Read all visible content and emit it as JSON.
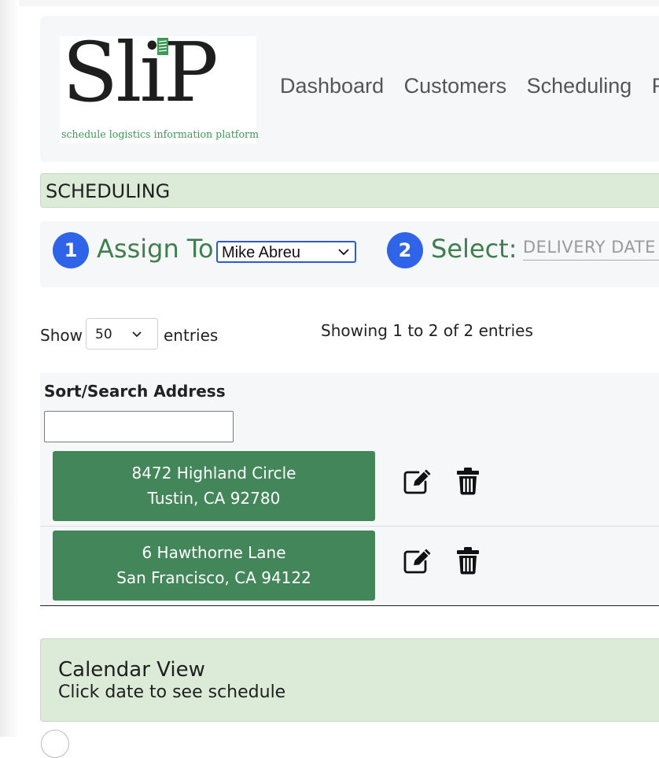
{
  "brand": {
    "logo_text": "SliP",
    "tagline": "schedule logistics information platform",
    "accent_green": "#43865a",
    "header_green": "#dcebd8",
    "step_blue": "#2f63e8"
  },
  "nav": {
    "items": [
      "Dashboard",
      "Customers",
      "Scheduling",
      "Rou"
    ]
  },
  "section": {
    "title": "SCHEDULING"
  },
  "assign": {
    "step1_number": "1",
    "step1_label": "Assign To:",
    "assignee_selected": "Mike Abreu",
    "step2_number": "2",
    "step2_label": "Select:",
    "date_placeholder": "DELIVERY DATE"
  },
  "table_controls": {
    "show_label": "Show",
    "page_length_selected": "50",
    "entries_label": "entries",
    "info_text": "Showing 1 to 2 of 2 entries"
  },
  "table": {
    "column_header": "Sort/Search Address",
    "search_value": "",
    "rows": [
      {
        "line1": "8472 Highland Circle",
        "line2": "Tustin, CA 92780"
      },
      {
        "line1": "6 Hawthorne Lane",
        "line2": "San Francisco, CA 94122"
      }
    ],
    "icons": {
      "edit": "edit-icon",
      "delete": "trash-icon"
    }
  },
  "calendar": {
    "title": "Calendar View",
    "subtitle": "Click date to see schedule"
  }
}
